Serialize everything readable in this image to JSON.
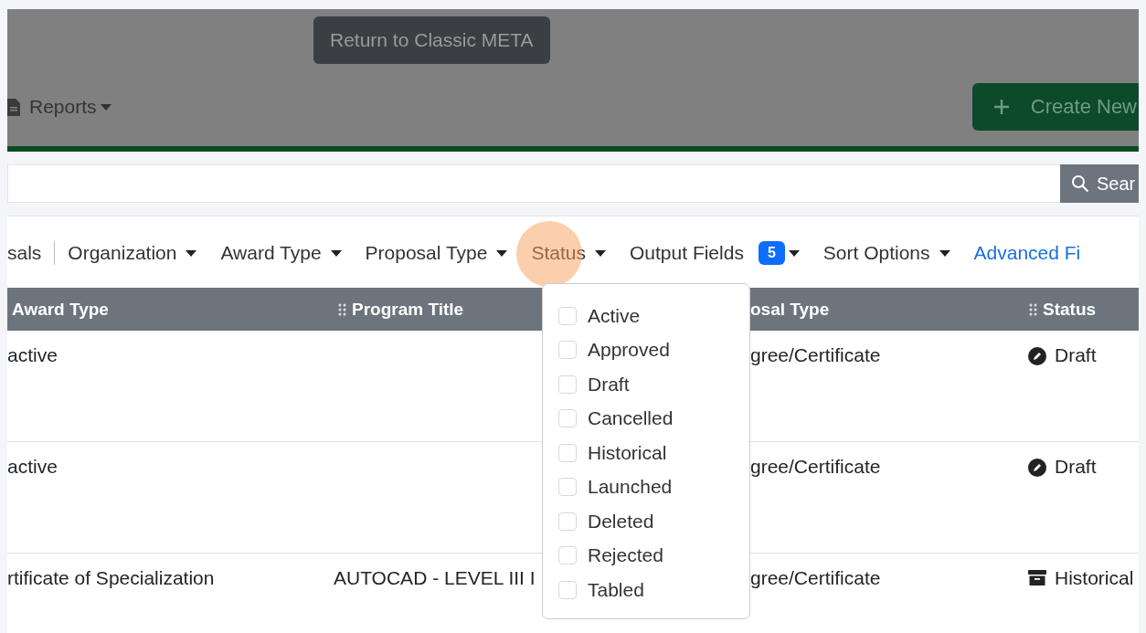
{
  "header": {
    "classic_button": "Return to Classic META",
    "reports_menu": "Reports",
    "create_button": "Create New"
  },
  "search": {
    "button": "Sear"
  },
  "filters": [
    {
      "kind": "text",
      "label": "sals"
    },
    {
      "kind": "dropdown",
      "label": "Organization"
    },
    {
      "kind": "dropdown",
      "label": "Award Type"
    },
    {
      "kind": "dropdown",
      "label": "Proposal Type"
    },
    {
      "kind": "dropdown",
      "label": "Status",
      "highlighted": true
    },
    {
      "kind": "dropdown",
      "label": "Output Fields",
      "badge": "5"
    },
    {
      "kind": "dropdown",
      "label": "Sort Options"
    },
    {
      "kind": "link",
      "label": "Advanced Fi"
    }
  ],
  "table": {
    "columns": [
      "Award Type",
      "Program Title",
      "osal Type",
      "Status"
    ],
    "rows": [
      {
        "award_type": "active",
        "program_title": "",
        "proposal_type": "gree/Certificate",
        "status": {
          "kind": "draft",
          "label": "Draft"
        }
      },
      {
        "award_type": "active",
        "program_title": "",
        "proposal_type": "gree/Certificate",
        "status": {
          "kind": "draft",
          "label": "Draft"
        }
      },
      {
        "award_type": "rtificate of Specialization",
        "program_title": "AUTOCAD - LEVEL III I",
        "proposal_type": "gree/Certificate",
        "status": {
          "kind": "historical",
          "label": "Historical"
        }
      }
    ]
  },
  "status_menu": {
    "options": [
      {
        "label": "Active",
        "checked": false
      },
      {
        "label": "Approved",
        "checked": false
      },
      {
        "label": "Draft",
        "checked": false
      },
      {
        "label": "Cancelled",
        "checked": false
      },
      {
        "label": "Historical",
        "checked": false
      },
      {
        "label": "Launched",
        "checked": false
      },
      {
        "label": "Deleted",
        "checked": false
      },
      {
        "label": "Rejected",
        "checked": false
      },
      {
        "label": "Tabled",
        "checked": false
      }
    ]
  }
}
